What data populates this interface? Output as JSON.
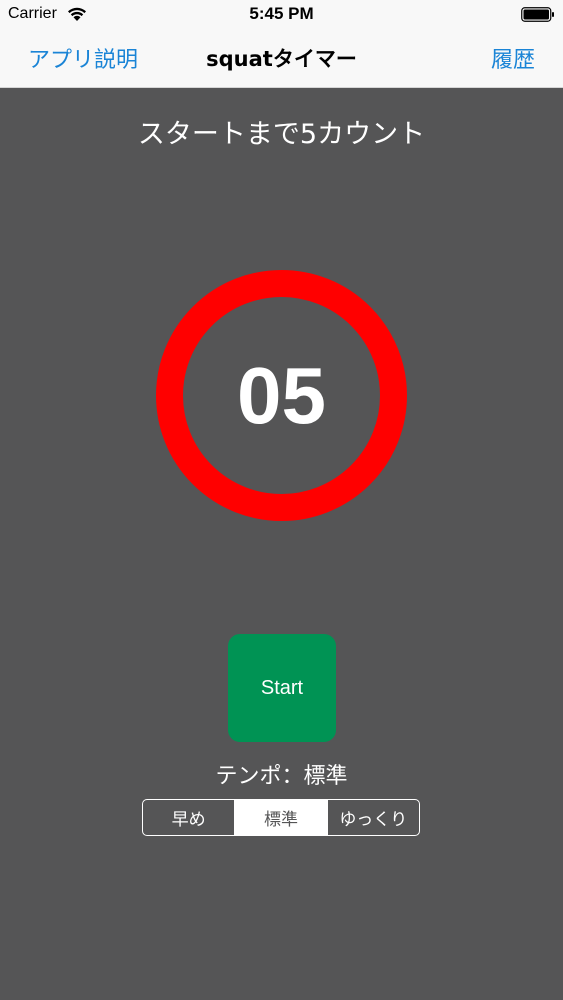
{
  "status_bar": {
    "carrier": "Carrier",
    "time": "5:45 PM",
    "wifi_icon": "wifi-icon",
    "battery_icon": "battery-icon"
  },
  "nav": {
    "left_button": "アプリ説明",
    "title": "squatタイマー",
    "right_button": "履歴",
    "accent_color": "#1a84d6"
  },
  "main": {
    "instruction": "スタートまで5カウント",
    "timer_value": "05",
    "ring_color": "#ff0000",
    "start_label": "Start",
    "start_color": "#009354",
    "tempo_label": "テンポ：標準",
    "tempo_options": [
      "早め",
      "標準",
      "ゆっくり"
    ],
    "tempo_selected": "標準",
    "background_color": "#555556"
  }
}
